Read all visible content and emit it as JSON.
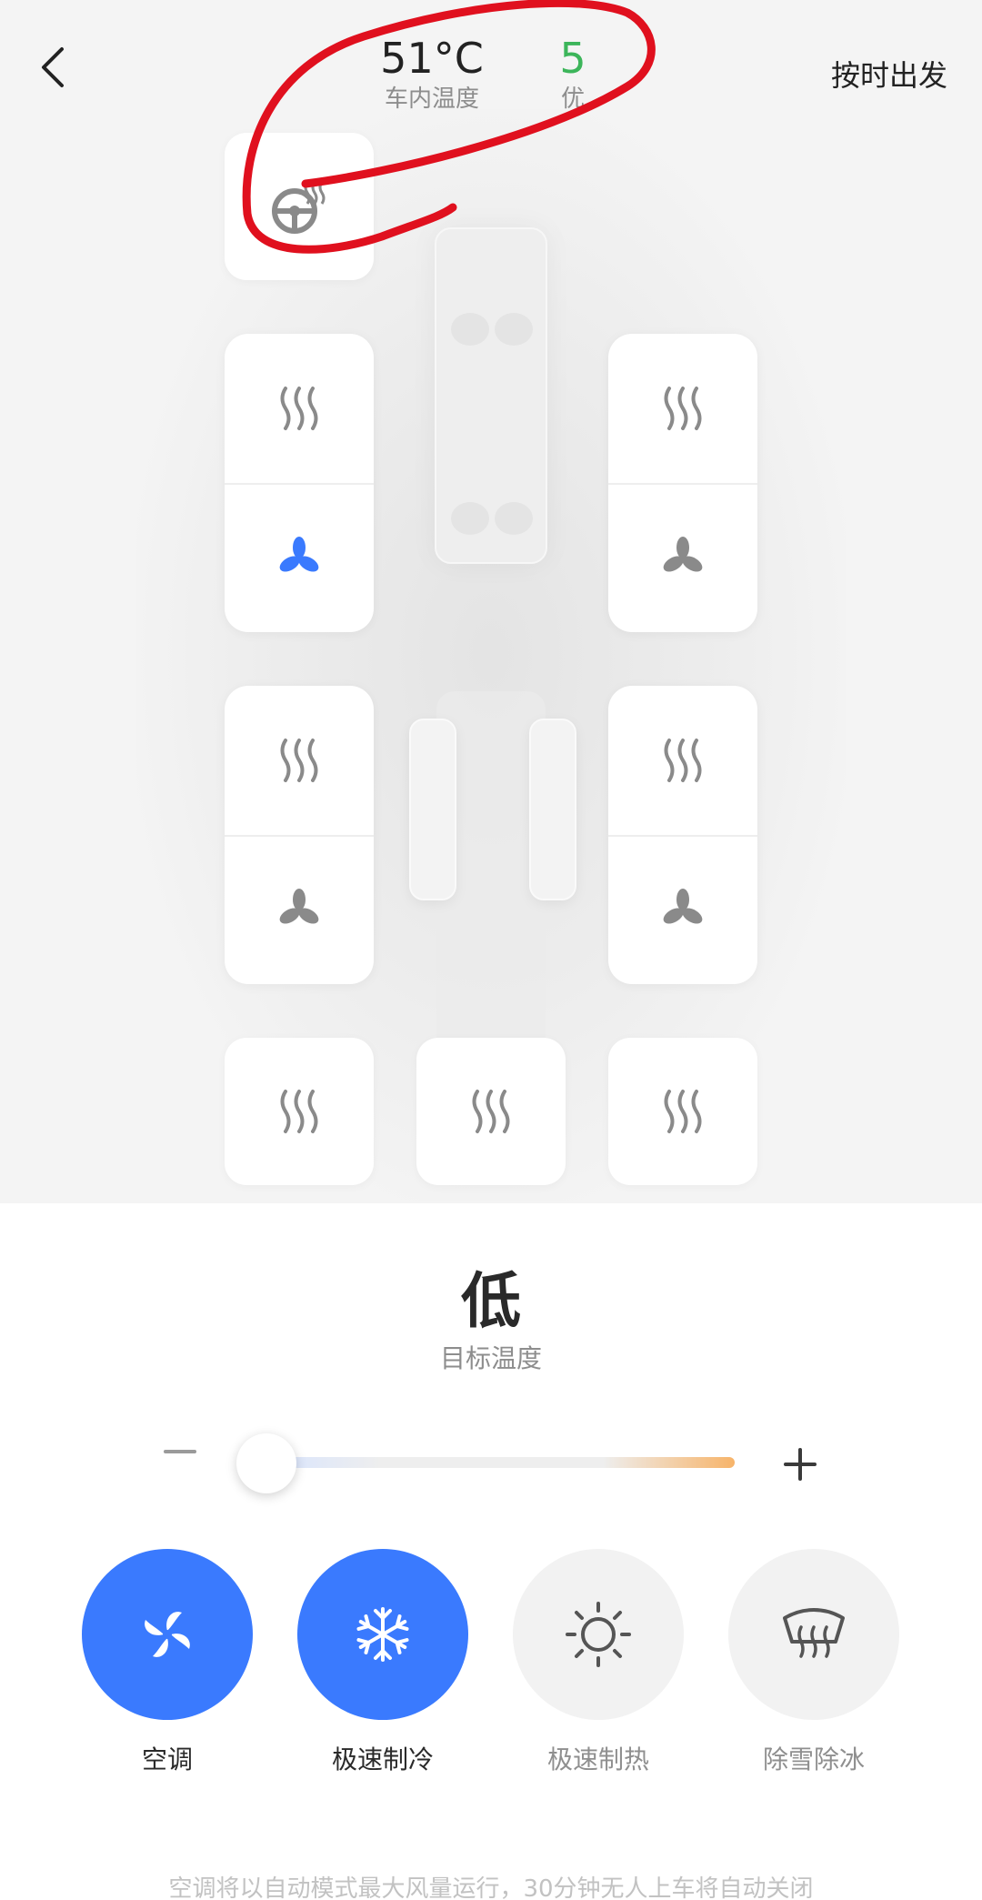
{
  "header": {
    "back_icon": "chevron-left-icon",
    "cabin_temp": "51°C",
    "cabin_temp_label": "车内温度",
    "air_quality_value": "5",
    "air_quality_label": "优",
    "air_quality_color": "#3cb55a",
    "depart_label": "按时出发"
  },
  "cabin": {
    "steering_heat_icon": "steering-wheel-heat-icon",
    "seats": [
      {
        "name": "driver",
        "heat_icon": "heat-icon",
        "vent_icon": "fan-icon",
        "vent_active": true
      },
      {
        "name": "front-passenger",
        "heat_icon": "heat-icon",
        "vent_icon": "fan-icon",
        "vent_active": false
      },
      {
        "name": "rear-left",
        "heat_icon": "heat-icon",
        "vent_icon": "fan-icon",
        "vent_active": false
      },
      {
        "name": "rear-right",
        "heat_icon": "heat-icon",
        "vent_icon": "fan-icon",
        "vent_active": false
      }
    ],
    "third_row": [
      "heat-icon",
      "heat-icon",
      "heat-icon"
    ]
  },
  "target": {
    "value": "低",
    "label": "目标温度",
    "slider_level": 0
  },
  "modes": [
    {
      "label": "空调",
      "icon": "ac-fan-icon",
      "active": true
    },
    {
      "label": "极速制冷",
      "icon": "snowflake-icon",
      "active": true
    },
    {
      "label": "极速制热",
      "icon": "sun-icon",
      "active": false
    },
    {
      "label": "除雪除冰",
      "icon": "defrost-icon",
      "active": false
    }
  ],
  "footer": {
    "note": "空调将以自动模式最大风量运行，30分钟无人上车将自动关闭"
  },
  "colors": {
    "accent": "#3a7afe",
    "icon_gray": "#8a8a8a",
    "annotation": "#e0101e"
  }
}
